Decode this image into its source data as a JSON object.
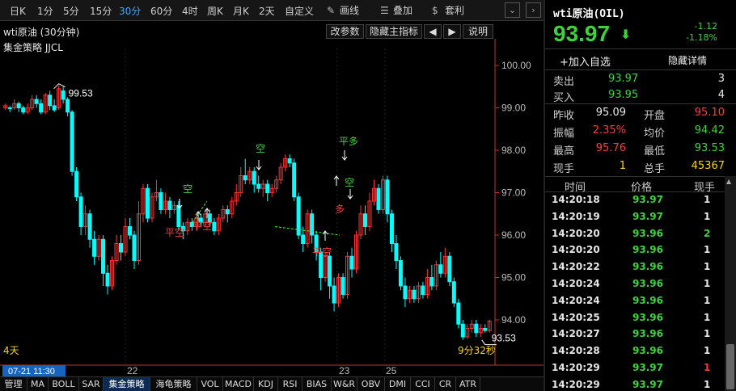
{
  "toolbar": {
    "periods": [
      "日K",
      "1分",
      "5分",
      "15分",
      "30分",
      "60分",
      "4时",
      "周K",
      "月K",
      "2天",
      "自定义"
    ],
    "active_period": "30分",
    "draw_label": "画线",
    "overlay_label": "叠加",
    "arbitrage_label": "套利"
  },
  "chart_header": {
    "title": "wti原油 (30分钟)",
    "strategy": "集金策略 JJCL",
    "buttons": [
      "改参数",
      "隐藏主指标",
      "说明"
    ]
  },
  "chart": {
    "y_ticks": [
      "100.00",
      "99.00",
      "98.00",
      "97.00",
      "96.00",
      "95.00",
      "94.00"
    ],
    "y_values": [
      100,
      99,
      98,
      97,
      96,
      95,
      94
    ],
    "y_range": [
      93.2,
      100.4
    ],
    "high_label": "99.53",
    "low_label": "93.53",
    "left_bottom_label": "4天",
    "right_bottom_label": "9分32秒",
    "x_date_box": "07-21 11:30",
    "x_ticks": [
      "22",
      "23",
      "25"
    ],
    "signals": [
      "平空",
      "空",
      "平空",
      "空",
      "平空",
      "平多",
      "空",
      "多"
    ],
    "colors": {
      "up": "#ff3333",
      "down": "#00ffff",
      "dash": "#33ff33"
    }
  },
  "bottom_tabs": [
    "管理",
    "MA",
    "BOLL",
    "SAR",
    "集金策略",
    "海龟策略",
    "VOL",
    "MACD",
    "KDJ",
    "RSI",
    "BIAS",
    "W&R",
    "OBV",
    "DMI",
    "CCI",
    "CR",
    "ATR"
  ],
  "active_tab": "集金策略",
  "quote": {
    "title": "wti原油(OIL)",
    "price": "93.97",
    "change": "-1.12",
    "change_pct": "-1.18%",
    "add_fav": "+加入自选",
    "hide_detail": "隐藏详情",
    "sell": {
      "label": "卖出",
      "price": "93.97",
      "vol": "3"
    },
    "buy": {
      "label": "买入",
      "price": "93.95",
      "vol": "4"
    },
    "stats": [
      {
        "l1": "昨收",
        "v1": "95.09",
        "l2": "开盘",
        "v2": "95.10"
      },
      {
        "l1": "振幅",
        "v1": "2.35%",
        "l2": "均价",
        "v2": "94.42"
      },
      {
        "l1": "最高",
        "v1": "95.76",
        "l2": "最低",
        "v2": "93.53"
      },
      {
        "l1": "现手",
        "v1": "1",
        "l2": "总手",
        "v2": "45367"
      }
    ],
    "tick_headers": [
      "时间",
      "价格",
      "现手"
    ],
    "ticks": [
      {
        "time": "14:20:18",
        "price": "93.97",
        "vol": "1"
      },
      {
        "time": "14:20:19",
        "price": "93.97",
        "vol": "1"
      },
      {
        "time": "14:20:20",
        "price": "93.96",
        "vol": "2"
      },
      {
        "time": "14:20:20",
        "price": "93.96",
        "vol": "1"
      },
      {
        "time": "14:20:22",
        "price": "93.96",
        "vol": "1"
      },
      {
        "time": "14:20:24",
        "price": "93.96",
        "vol": "1"
      },
      {
        "time": "14:20:24",
        "price": "93.96",
        "vol": "1"
      },
      {
        "time": "14:20:25",
        "price": "93.96",
        "vol": "1"
      },
      {
        "time": "14:20:27",
        "price": "93.96",
        "vol": "1"
      },
      {
        "time": "14:20:28",
        "price": "93.96",
        "vol": "1"
      },
      {
        "time": "14:20:29",
        "price": "93.97",
        "vol": "1"
      },
      {
        "time": "14:20:29",
        "price": "93.97",
        "vol": "1"
      }
    ]
  }
}
